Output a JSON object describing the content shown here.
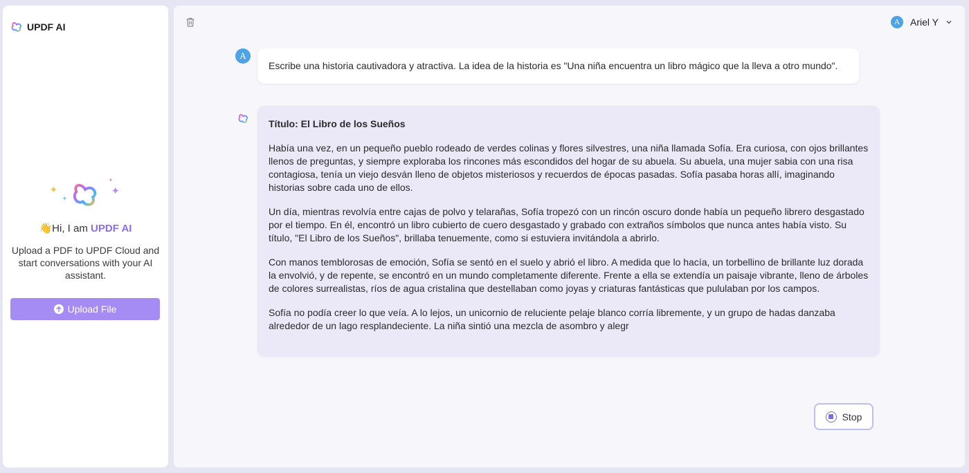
{
  "sidebar": {
    "brand": "UPDF AI",
    "greeting_prefix": "👋Hi, I am ",
    "greeting_highlight": "UPDF AI",
    "description": "Upload a PDF to UPDF Cloud and start conversations with your AI assistant.",
    "upload_label": "Upload File"
  },
  "header": {
    "user_initial": "A",
    "user_name": "Ariel Y"
  },
  "chat": {
    "user_initial": "A",
    "user_message": "Escribe una historia cautivadora y atractiva. La idea de la historia es \"Una niña encuentra un libro mágico que la lleva a otro mundo\".",
    "ai_title": "Título: El Libro de los Sueños",
    "ai_paragraphs": [
      "Había una vez, en un pequeño pueblo rodeado de verdes colinas y flores silvestres, una niña llamada Sofía. Era curiosa, con ojos brillantes llenos de preguntas, y siempre exploraba los rincones más escondidos del hogar de su abuela. Su abuela, una mujer sabia con una risa contagiosa, tenía un viejo desván lleno de objetos misteriosos y recuerdos de épocas pasadas. Sofía pasaba horas allí, imaginando historias sobre cada uno de ellos.",
      "Un día, mientras revolvía entre cajas de polvo y telarañas, Sofía tropezó con un rincón oscuro donde había un pequeño librero desgastado por el tiempo. En él, encontró un libro cubierto de cuero desgastado y grabado con extraños símbolos que nunca antes había visto. Su título, \"El Libro de los Sueños\", brillaba tenuemente, como si estuviera invitándola a abrirlo.",
      "Con manos temblorosas de emoción, Sofía se sentó en el suelo y abrió el libro. A medida que lo hacía, un torbellino de brillante luz dorada la envolvió, y de repente, se encontró en un mundo completamente diferente. Frente a ella se extendía un paisaje vibrante, lleno de árboles de colores surrealistas, ríos de agua cristalina que destellaban como joyas y criaturas fantásticas que pululaban por los campos.",
      "Sofía no podía creer lo que veía. A lo lejos, un unicornio de reluciente pelaje blanco corría libremente, y un grupo de hadas danzaba alrededor de un lago resplandeciente. La niña sintió una mezcla de asombro y alegr"
    ],
    "stop_label": "Stop"
  },
  "colors": {
    "accent": "#a58cf5",
    "highlight": "#8a6cf6",
    "avatar": "#4ea3e6",
    "ai_bubble": "#ebe9f8"
  },
  "icons": [
    "updf-logo-icon",
    "trash-icon",
    "chevron-down-icon",
    "sparkle-icon",
    "upload-icon",
    "stop-icon"
  ]
}
